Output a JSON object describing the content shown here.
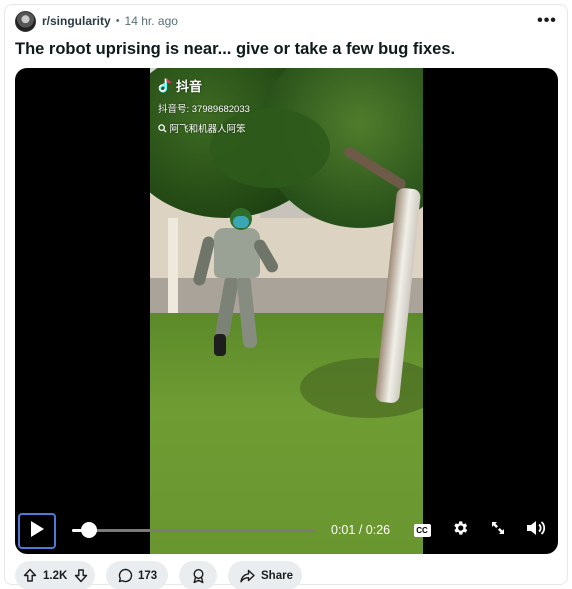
{
  "post": {
    "subreddit": "r/singularity",
    "separator": "•",
    "time": "14 hr. ago",
    "overflow": "•••",
    "title": "The robot uprising is near... give or take a few bug fixes."
  },
  "video": {
    "watermark": {
      "app_name": "抖音",
      "account_id": "抖音号: 37989682033",
      "search_text": "阿飞和机器人阿笨"
    },
    "progress": 0.07,
    "time_current": "0:01",
    "time_separator": " / ",
    "time_total": "0:26",
    "cc_label": "CC"
  },
  "actions": {
    "votes": "1.2K",
    "comments": "173",
    "share": "Share"
  },
  "colors": {
    "focus_ring": "#4a7bd9",
    "pill_bg": "#eaedef"
  },
  "icons": {
    "play": "play-icon",
    "settings": "gear-icon",
    "fullscreen": "expand-icon",
    "volume": "volume-icon",
    "upvote": "arrow-up-icon",
    "downvote": "arrow-down-icon",
    "comment": "speech-bubble-icon",
    "award": "award-icon",
    "share": "share-arrow-icon"
  }
}
